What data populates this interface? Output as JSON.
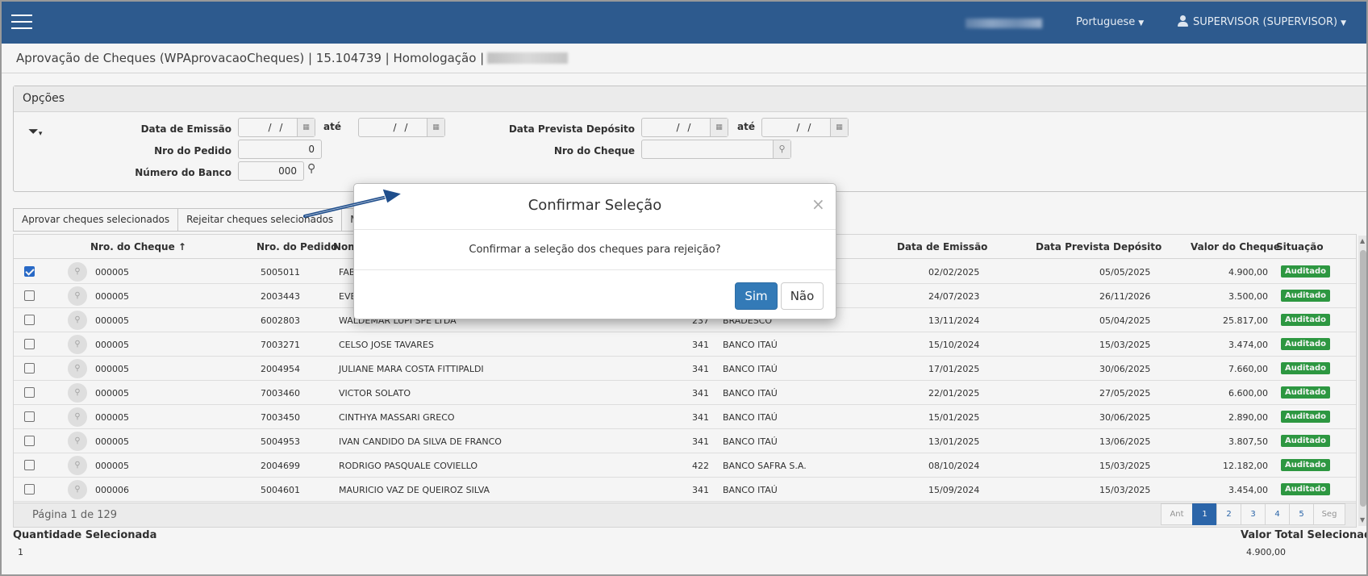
{
  "topbar": {
    "language": "Portuguese",
    "user": "SUPERVISOR (SUPERVISOR)"
  },
  "page": {
    "title": "Aprovação de Cheques (WPAprovacaoCheques) | 15.104739 | Homologação |"
  },
  "options": {
    "title": "Opções",
    "data_emissao_label": "Data de Emissão",
    "ate_label": "até",
    "date_placeholder": "/ /",
    "data_prevista_label": "Data Prevista Depósito",
    "nro_pedido_label": "Nro do Pedido",
    "nro_pedido_value": "0",
    "nro_cheque_label": "Nro do Cheque",
    "numero_banco_label": "Número do Banco",
    "numero_banco_value": "000"
  },
  "actions": {
    "aprovar": "Aprovar cheques selecionados",
    "rejeitar": "Rejeitar cheques selecionados",
    "marcar": "Marcar"
  },
  "grid": {
    "headers": {
      "nro_cheque": "Nro. do Cheque",
      "nro_pedido": "Nro. do Pedido",
      "nome": "Nom",
      "data_emissao": "Data de Emissão",
      "data_prevista": "Data Prevista Depósito",
      "valor": "Valor do Cheque",
      "situacao": "Situação"
    },
    "rows": [
      {
        "checked": true,
        "cheque": "000005",
        "pedido": "5005011",
        "nome": "FAB",
        "banco_cod": "",
        "banco": "",
        "emissao": "02/02/2025",
        "prevista": "05/05/2025",
        "valor": "4.900,00",
        "situacao": "Auditado"
      },
      {
        "checked": false,
        "cheque": "000005",
        "pedido": "2003443",
        "nome": "EVE",
        "banco_cod": "",
        "banco": "",
        "emissao": "24/07/2023",
        "prevista": "26/11/2026",
        "valor": "3.500,00",
        "situacao": "Auditado"
      },
      {
        "checked": false,
        "cheque": "000005",
        "pedido": "6002803",
        "nome": "WALDEMAR LUPI SPE LTDA",
        "banco_cod": "237",
        "banco": "BRADESCO",
        "emissao": "13/11/2024",
        "prevista": "05/04/2025",
        "valor": "25.817,00",
        "situacao": "Auditado"
      },
      {
        "checked": false,
        "cheque": "000005",
        "pedido": "7003271",
        "nome": "CELSO JOSE TAVARES",
        "banco_cod": "341",
        "banco": "BANCO ITAÚ",
        "emissao": "15/10/2024",
        "prevista": "15/03/2025",
        "valor": "3.474,00",
        "situacao": "Auditado"
      },
      {
        "checked": false,
        "cheque": "000005",
        "pedido": "2004954",
        "nome": "JULIANE MARA COSTA FITTIPALDI",
        "banco_cod": "341",
        "banco": "BANCO ITAÚ",
        "emissao": "17/01/2025",
        "prevista": "30/06/2025",
        "valor": "7.660,00",
        "situacao": "Auditado"
      },
      {
        "checked": false,
        "cheque": "000005",
        "pedido": "7003460",
        "nome": "VICTOR SOLATO",
        "banco_cod": "341",
        "banco": "BANCO ITAÚ",
        "emissao": "22/01/2025",
        "prevista": "27/05/2025",
        "valor": "6.600,00",
        "situacao": "Auditado"
      },
      {
        "checked": false,
        "cheque": "000005",
        "pedido": "7003450",
        "nome": "CINTHYA MASSARI GRECO",
        "banco_cod": "341",
        "banco": "BANCO ITAÚ",
        "emissao": "15/01/2025",
        "prevista": "30/06/2025",
        "valor": "2.890,00",
        "situacao": "Auditado"
      },
      {
        "checked": false,
        "cheque": "000005",
        "pedido": "5004953",
        "nome": "IVAN CANDIDO DA SILVA DE FRANCO",
        "banco_cod": "341",
        "banco": "BANCO ITAÚ",
        "emissao": "13/01/2025",
        "prevista": "13/06/2025",
        "valor": "3.807,50",
        "situacao": "Auditado"
      },
      {
        "checked": false,
        "cheque": "000005",
        "pedido": "2004699",
        "nome": "RODRIGO PASQUALE COVIELLO",
        "banco_cod": "422",
        "banco": "BANCO SAFRA S.A.",
        "emissao": "08/10/2024",
        "prevista": "15/03/2025",
        "valor": "12.182,00",
        "situacao": "Auditado"
      },
      {
        "checked": false,
        "cheque": "000006",
        "pedido": "5004601",
        "nome": "MAURICIO VAZ DE QUEIROZ SILVA",
        "banco_cod": "341",
        "banco": "BANCO ITAÚ",
        "emissao": "15/09/2024",
        "prevista": "15/03/2025",
        "valor": "3.454,00",
        "situacao": "Auditado"
      }
    ],
    "page_info": "Página 1 de 129",
    "pager": [
      "Ant",
      "1",
      "2",
      "3",
      "4",
      "5",
      "Seg"
    ]
  },
  "summary": {
    "qtd_label": "Quantidade Selecionada",
    "qtd_value": "1",
    "total_label": "Valor Total Selecionado",
    "total_value": "4.900,00"
  },
  "modal": {
    "title": "Confirmar Seleção",
    "close": "×",
    "message": "Confirmar a seleção dos cheques para rejeição?",
    "yes": "Sim",
    "no": "Não"
  },
  "colors": {
    "topbar": "#2d5a8e",
    "primary_button": "#337ab7",
    "badge": "#2f9e44",
    "annotation_arrow": "#1f4e8c"
  }
}
